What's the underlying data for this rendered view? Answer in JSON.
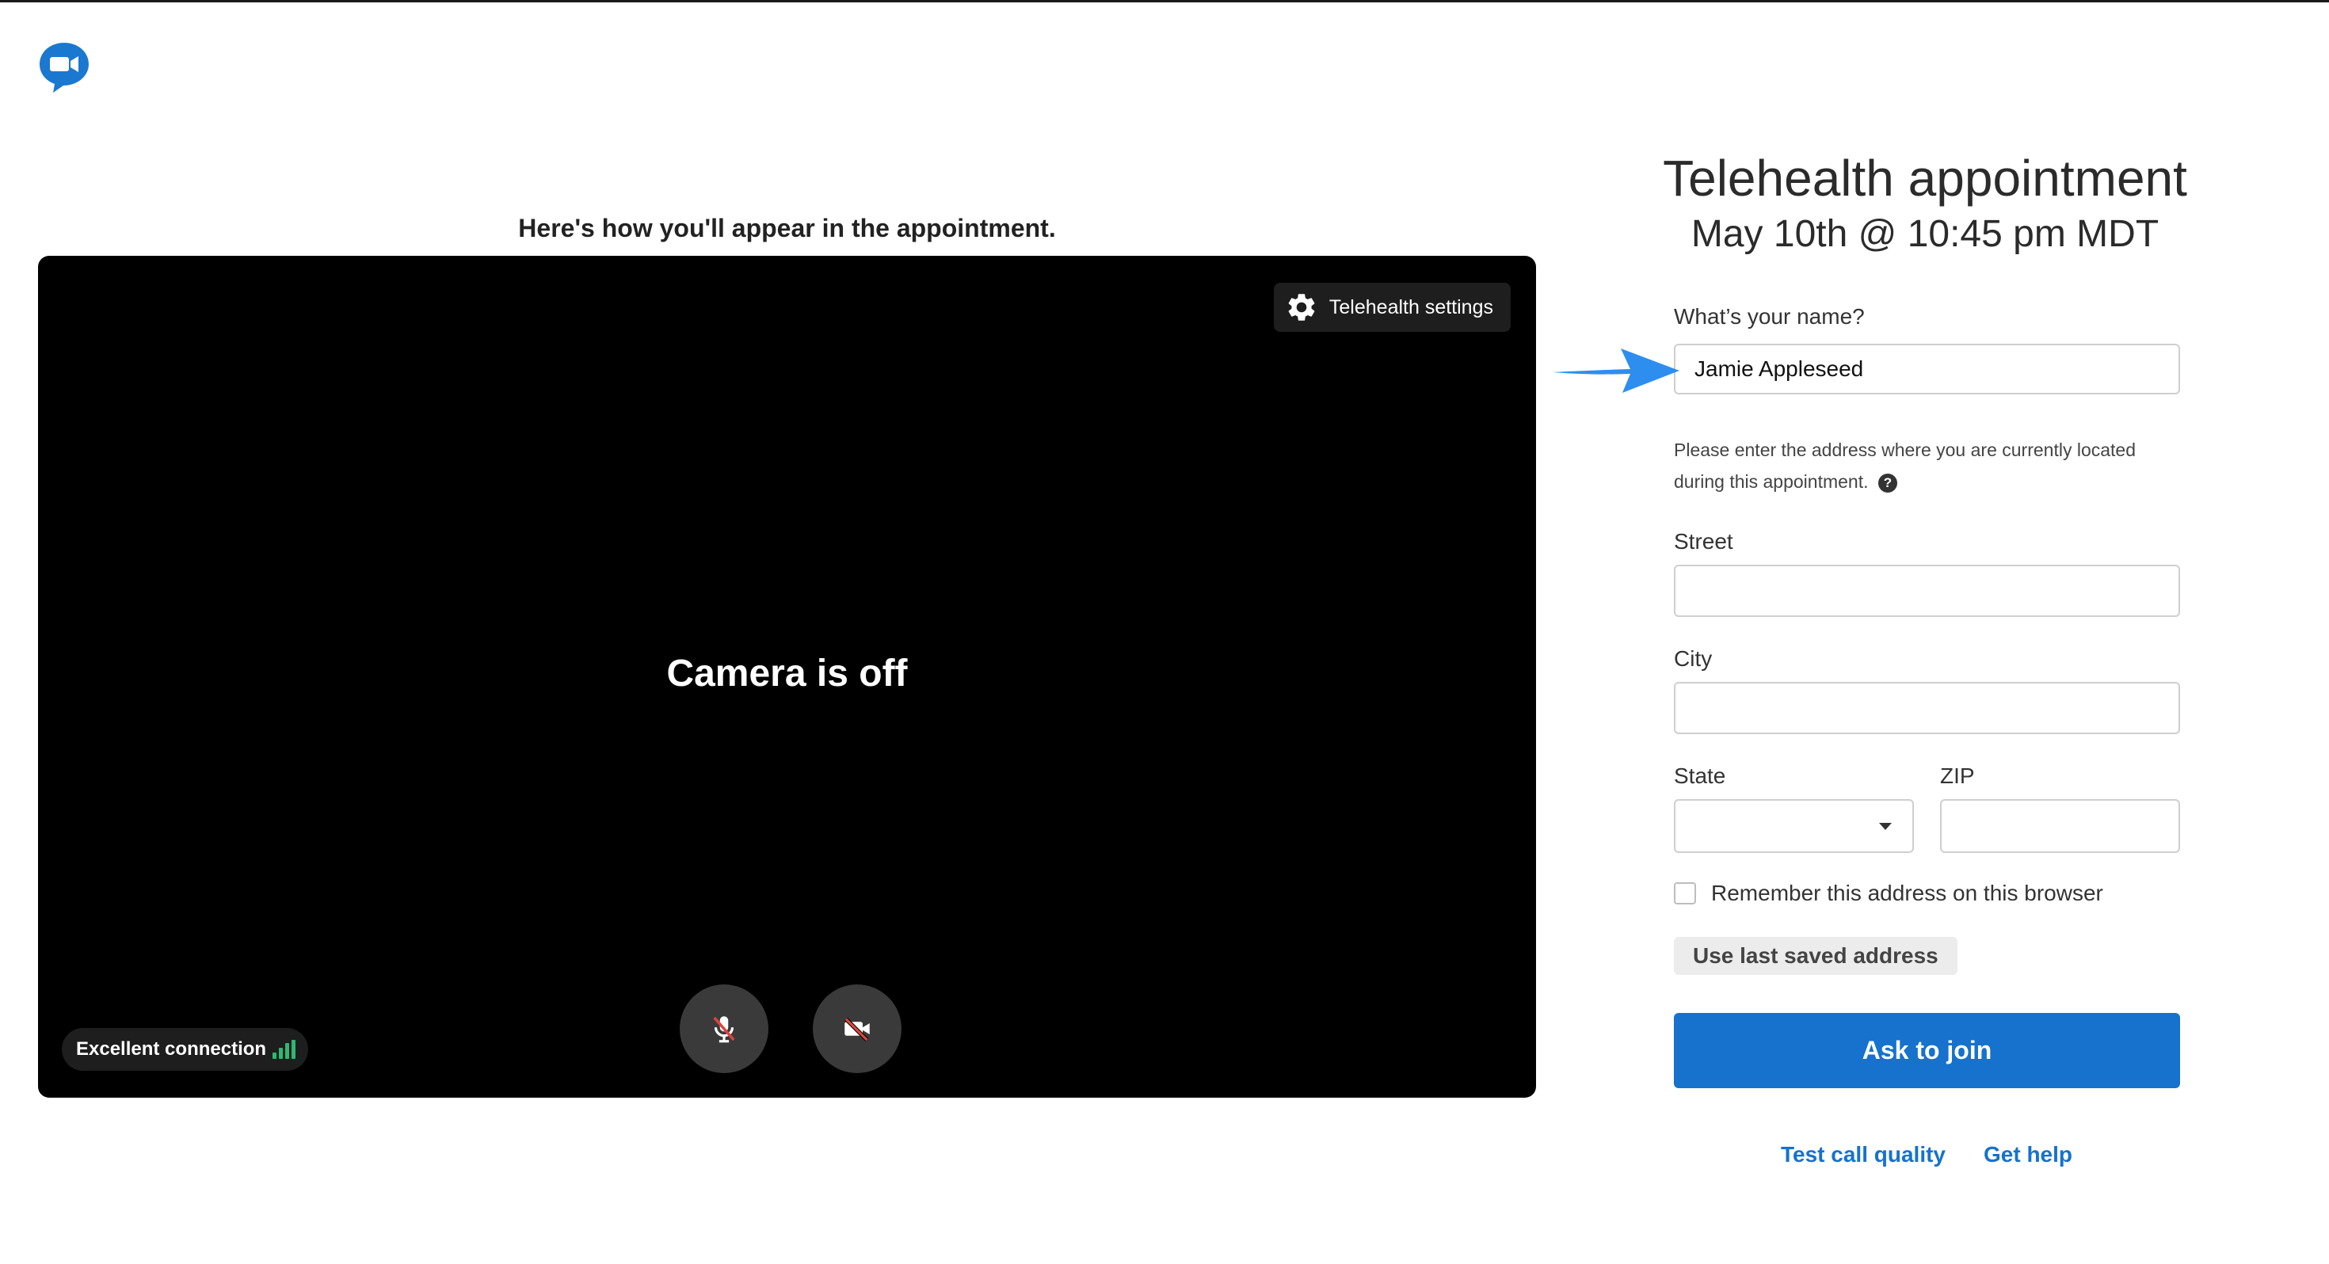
{
  "preview": {
    "caption": "Here's how you'll appear in the appointment.",
    "settings_label": "Telehealth settings",
    "camera_status": "Camera is off",
    "connection_label": "Excellent connection"
  },
  "appointment": {
    "title": "Telehealth appointment",
    "datetime": "May 10th @ 10:45 pm MDT"
  },
  "form": {
    "name_label": "What’s your name?",
    "name_value": "Jamie Appleseed",
    "address_help": "Please enter the address where you are currently located during this appointment.",
    "street_label": "Street",
    "street_value": "",
    "city_label": "City",
    "city_value": "",
    "state_label": "State",
    "state_value": "",
    "zip_label": "ZIP",
    "zip_value": "",
    "remember_label": "Remember this address on this browser",
    "remember_checked": false,
    "use_saved_label": "Use last saved address",
    "join_label": "Ask to join"
  },
  "footer_links": {
    "test_call": "Test call quality",
    "get_help": "Get help"
  },
  "colors": {
    "primary": "#1672cc",
    "logo": "#1b78d0",
    "signal": "#2fb872",
    "muted_slash": "#e0443a",
    "annotation_arrow": "#2d8ef0"
  }
}
